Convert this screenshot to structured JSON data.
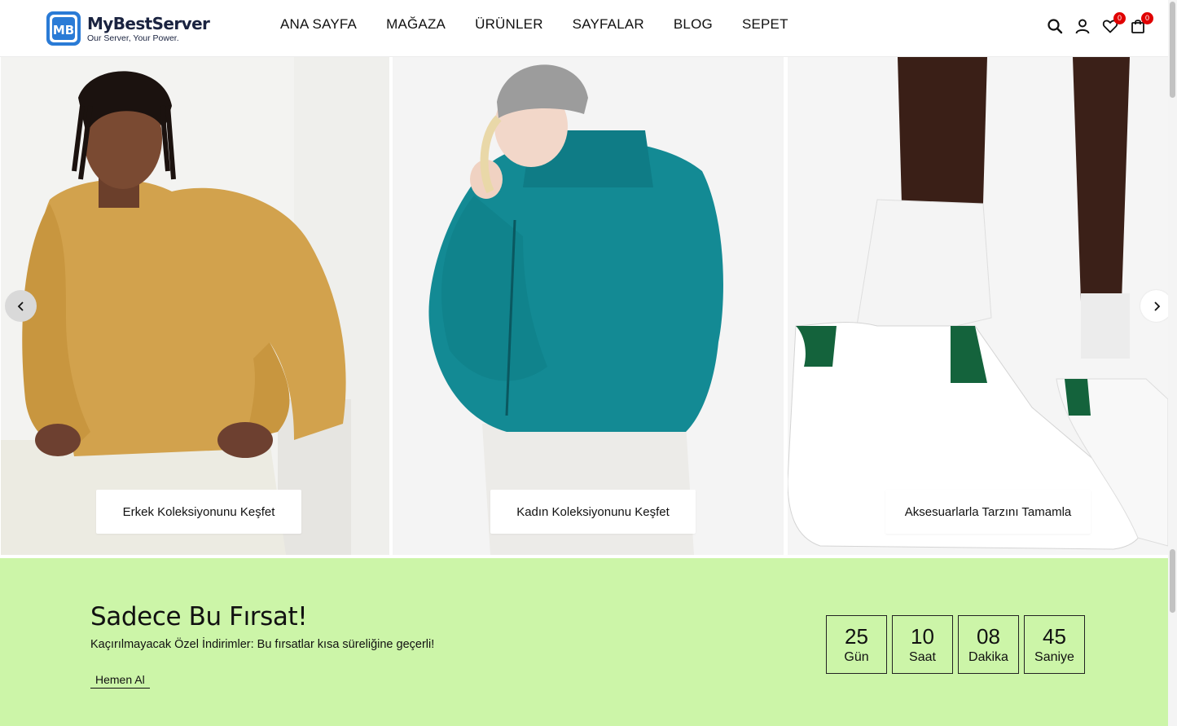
{
  "brand": {
    "name": "MyBestServer",
    "tagline": "Our Server, Your Power.",
    "logo_initials": "MB",
    "color": "#2a7bd6"
  },
  "nav": {
    "items": [
      {
        "label": "ANA SAYFA"
      },
      {
        "label": "MAĞAZA"
      },
      {
        "label": "ÜRÜNLER"
      },
      {
        "label": "SAYFALAR"
      },
      {
        "label": "BLOG"
      },
      {
        "label": "SEPET"
      }
    ]
  },
  "header_icons": {
    "search": "search-icon",
    "account": "user-icon",
    "wishlist": {
      "icon": "heart-icon",
      "count": "0"
    },
    "cart": {
      "icon": "shopping-bag-icon",
      "count": "0"
    }
  },
  "slider": {
    "prev_icon": "chevron-left-icon",
    "next_icon": "chevron-right-icon",
    "slides": [
      {
        "button": "Erkek Koleksiyonunu Keşfet",
        "image": "man in mustard sweatshirt"
      },
      {
        "button": "Kadın Koleksiyonunu Keşfet",
        "image": "woman in teal teddy puffer jacket"
      },
      {
        "button": "Aksesuarlarla Tarzını Tamamla",
        "image": "white sneakers with green heel tab"
      }
    ]
  },
  "promo": {
    "title": "Sadece Bu Fırsat!",
    "subtitle": "Kaçırılmayacak Özel İndirimler: Bu fırsatlar kısa süreliğine geçerli!",
    "link": "Hemen Al",
    "background": "#ccf5a8",
    "countdown": [
      {
        "value": "25",
        "label": "Gün"
      },
      {
        "value": "10",
        "label": "Saat"
      },
      {
        "value": "08",
        "label": "Dakika"
      },
      {
        "value": "45",
        "label": "Saniye"
      }
    ]
  },
  "badge_color": "#e00000"
}
